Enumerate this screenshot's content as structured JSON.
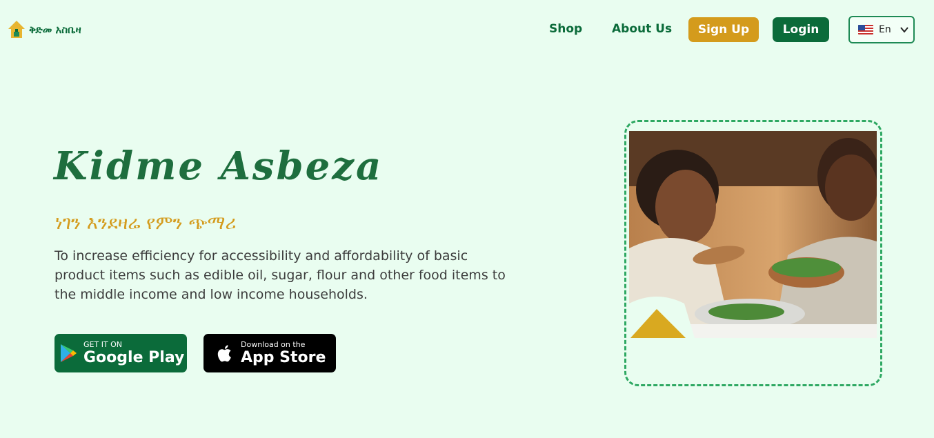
{
  "header": {
    "logo_text": "ቅድመ አስቤዛ",
    "nav": {
      "shop": "Shop",
      "about": "About Us"
    },
    "signup": "Sign Up",
    "login": "Login",
    "language": {
      "selected": "En",
      "flag_icon": "us-flag-icon"
    }
  },
  "hero": {
    "title": "Kidme Asbeza",
    "tagline": "ነገን እንደዛሬ የምን ጭማሪ",
    "description": "To increase efficiency for accessibility and affordability of basic product items such as edible oil, sugar, flour and other food items to the middle income and low income households."
  },
  "stores": {
    "google": {
      "small": "GET IT ON",
      "big": "Google Play",
      "icon": "google-play-icon"
    },
    "apple": {
      "small": "Download on the",
      "big": "App Store",
      "icon": "apple-icon"
    }
  },
  "colors": {
    "background": "#e9fdf0",
    "primary_green": "#0b6b3a",
    "gold": "#d49b1c",
    "frame_green": "#2ea862"
  }
}
